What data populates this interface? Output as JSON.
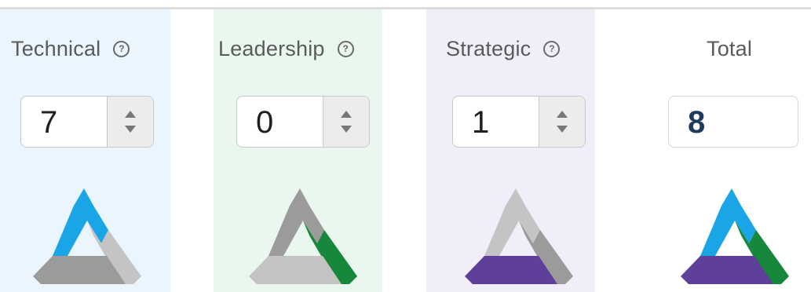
{
  "columns": [
    {
      "id": "technical",
      "label": "Technical",
      "value": "7",
      "help_icon": "?"
    },
    {
      "id": "leadership",
      "label": "Leadership",
      "value": "0",
      "help_icon": "?"
    },
    {
      "id": "strategic",
      "label": "Strategic",
      "value": "1",
      "help_icon": "?"
    }
  ],
  "total": {
    "label": "Total",
    "value": "8"
  },
  "colors": {
    "technical": "#1aa6e6",
    "leadership": "#17873c",
    "strategic": "#5e3f9a",
    "inactive_dark": "#9b9b9b",
    "inactive_light": "#c4c4c4",
    "technical_bg": "#eaf5fd",
    "leadership_bg": "#eaf7ee",
    "strategic_bg": "#f1eef9"
  }
}
